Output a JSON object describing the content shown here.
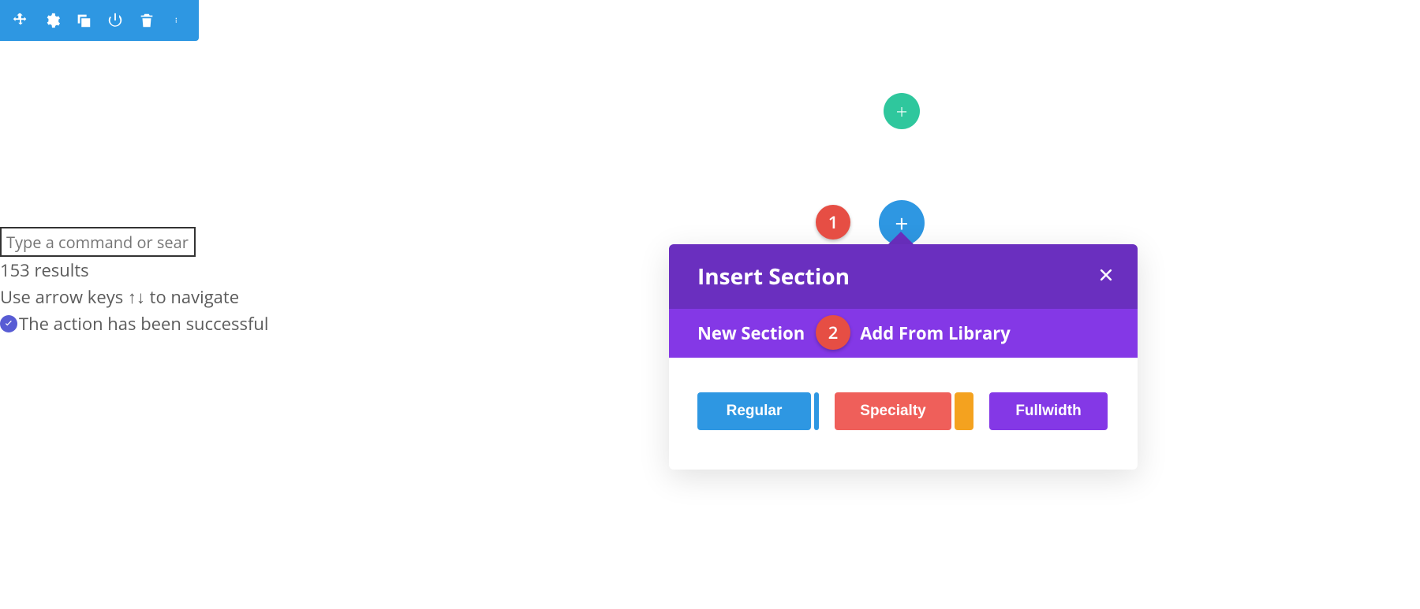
{
  "toolbar": {
    "icons": [
      "move",
      "gear",
      "duplicate",
      "power",
      "trash",
      "more"
    ]
  },
  "helper": {
    "placeholder": "Type a command or search…",
    "results_text": "153 results",
    "nav_hint": "Use arrow keys ↑↓ to navigate",
    "success_text": "The action has been successful"
  },
  "annotations": {
    "badge1": "1",
    "badge2": "2"
  },
  "panel": {
    "title": "Insert Section",
    "tabs": {
      "new": "New Section",
      "library": "Add From Library"
    },
    "types": {
      "regular": "Regular",
      "specialty": "Specialty",
      "fullwidth": "Fullwidth"
    }
  },
  "plus_glyph": "+"
}
